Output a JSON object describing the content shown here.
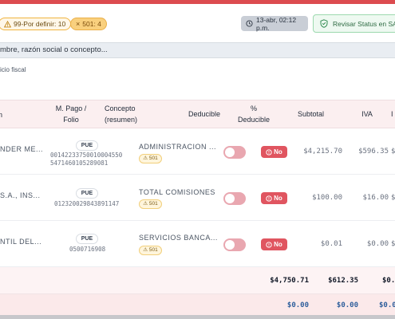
{
  "header": {
    "warn_badge": "99-Por definir: 10",
    "badge_501": "501: 4",
    "date": "13-abr, 02:12 p.m.",
    "sat_button": "Revisar Status en SAT"
  },
  "search": {
    "placeholder": "mbre, razón social o concepto..."
  },
  "hint": "icio fiscal",
  "table": {
    "columns": {
      "name": "n",
      "pago": "M. Pago /",
      "folio": "Folio",
      "concepto": "Concepto",
      "resumen": "(resumen)",
      "deducible": "Deducible",
      "pct": "%",
      "pct2": "Deducible",
      "subtotal": "Subtotal",
      "iva": "IVA",
      "last": "I"
    },
    "rows": [
      {
        "name": "NDER ME...",
        "method": "PUE",
        "folio1": "00142233750010004550",
        "folio2": "5471460105289081",
        "concept": "ADMINISTRACION ...",
        "tag": "501",
        "deducible": "No",
        "subtotal": "$4,215.70",
        "iva": "$596.35",
        "last": "$"
      },
      {
        "name": "S.A., INS...",
        "method": "PUE",
        "folio1": "012320029843891147",
        "folio2": "",
        "concept": "TOTAL COMISIONES",
        "tag": "501",
        "deducible": "No",
        "subtotal": "$100.00",
        "iva": "$16.00",
        "last": "$"
      },
      {
        "name": "NTIL DEL...",
        "method": "PUE",
        "folio1": "0500716908",
        "folio2": "",
        "concept": "SERVICIOS BANCA...",
        "tag": "501",
        "deducible": "No",
        "subtotal": "$0.01",
        "iva": "$0.00",
        "last": "$"
      }
    ],
    "totals": {
      "subtotal": "$4,750.71",
      "iva": "$612.35",
      "last": "$0."
    },
    "totals2": {
      "a": "$0.00",
      "b": "$0.00",
      "c": "$0.00",
      "last": "$0."
    }
  },
  "colors": {
    "accent": "#dc4b4f",
    "no_badge": "#e05560",
    "toggle": "#e9a7b0"
  }
}
